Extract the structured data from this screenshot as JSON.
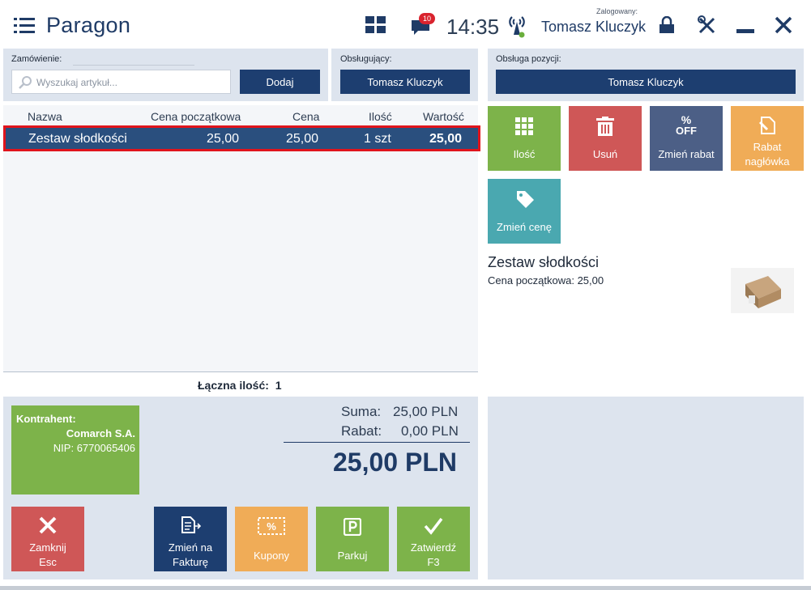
{
  "header": {
    "title": "Paragon",
    "notification_count": "10",
    "time": "14:35",
    "logged_in_label": "Zalogowany:",
    "user": "Tomasz Kluczyk"
  },
  "order": {
    "label": "Zamówienie:",
    "search_placeholder": "Wyszukaj artykuł...",
    "add_label": "Dodaj"
  },
  "cashier": {
    "label": "Obsługujący:",
    "value": "Tomasz Kluczyk"
  },
  "position_handler": {
    "label": "Obsługa pozycji:",
    "value": "Tomasz Kluczyk"
  },
  "table": {
    "columns": [
      "Nazwa",
      "Cena początkowa",
      "Cena",
      "Ilość",
      "Wartość"
    ],
    "rows": [
      {
        "name": "Zestaw słodkości",
        "initial_price": "25,00",
        "price": "25,00",
        "qty": "1 szt",
        "value": "25,00"
      }
    ],
    "total_qty_label": "Łączna ilość:",
    "total_qty_value": "1"
  },
  "actions": {
    "qty": "Ilość",
    "delete": "Usuń",
    "change_discount": "Zmień rabat",
    "discount_line1": "Rabat",
    "discount_line2": "nagłówka",
    "change_price": "Zmień cenę",
    "off_text": "OFF",
    "percent_text": "%"
  },
  "detail": {
    "name": "Zestaw słodkości",
    "price_label": "Cena początkowa: 25,00"
  },
  "contractor": {
    "label": "Kontrahent:",
    "name": "Comarch S.A.",
    "nip": "NIP: 6770065406"
  },
  "summary": {
    "sum_label": "Suma:",
    "sum_value": "25,00 PLN",
    "discount_label": "Rabat:",
    "discount_value": "0,00 PLN",
    "total": "25,00 PLN"
  },
  "bottom": {
    "close_line1": "Zamknij",
    "close_line2": "Esc",
    "invoice_line1": "Zmień na",
    "invoice_line2": "Fakturę",
    "coupons": "Kupony",
    "park": "Parkuj",
    "confirm_line1": "Zatwierdź",
    "confirm_line2": "F3"
  },
  "colors": {
    "navy": "#1d3e70",
    "green": "#7db34a",
    "red": "#cf5757",
    "slate": "#4c5f86",
    "orange": "#f0ac57",
    "teal": "#4aa8b0",
    "selection_border": "#e0141c"
  }
}
